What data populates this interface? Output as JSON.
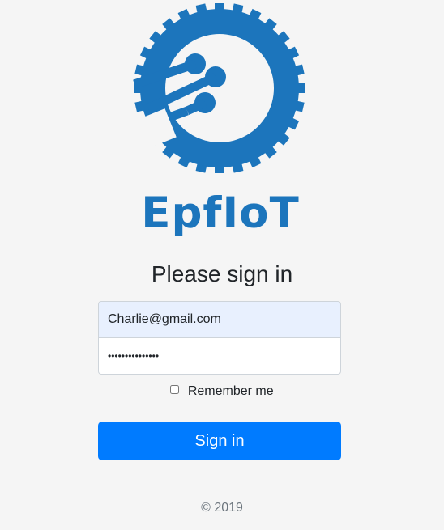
{
  "brand": {
    "logo_icon": "gear-circuit-logo-icon",
    "name": "EpfIoT",
    "color": "#1c75bc"
  },
  "form": {
    "heading": "Please sign in",
    "email_value": "Charlie@gmail.com",
    "password_value": "•••••••••••••••",
    "remember_label": "Remember me",
    "remember_checked": false,
    "submit_label": "Sign in",
    "submit_color": "#007bff"
  },
  "footer": {
    "copyright": "© 2019"
  }
}
